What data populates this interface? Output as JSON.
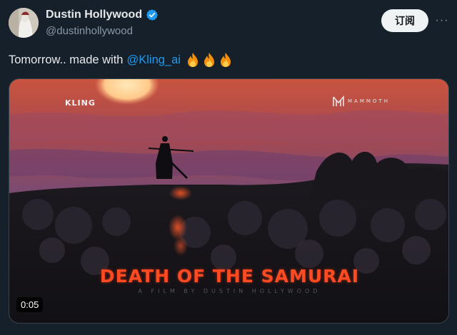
{
  "author": {
    "display_name": "Dustin Hollywood",
    "handle": "@dustinhollywood",
    "verified_icon": "verified-badge-icon",
    "avatar_icon": "avatar-image"
  },
  "header": {
    "subscribe_label": "订阅",
    "more_icon": "more-horizontal-icon",
    "more_label": "···"
  },
  "tweet": {
    "text": "Tomorrow.. made with",
    "mention": "@Kling_ai",
    "emojis": [
      "fire-emoji",
      "fire-emoji",
      "fire-emoji"
    ]
  },
  "media": {
    "logo_left": "KLING",
    "logo_right": "MAMMOTH",
    "title": "DEATH OF THE SAMURAI",
    "credit": "A FILM BY DUSTIN HOLLYWOOD",
    "duration": "0:05"
  },
  "colors": {
    "background": "#15202b",
    "link": "#1d9bf0",
    "title_red": "#ff4a22",
    "verified": "#1d9bf0"
  }
}
